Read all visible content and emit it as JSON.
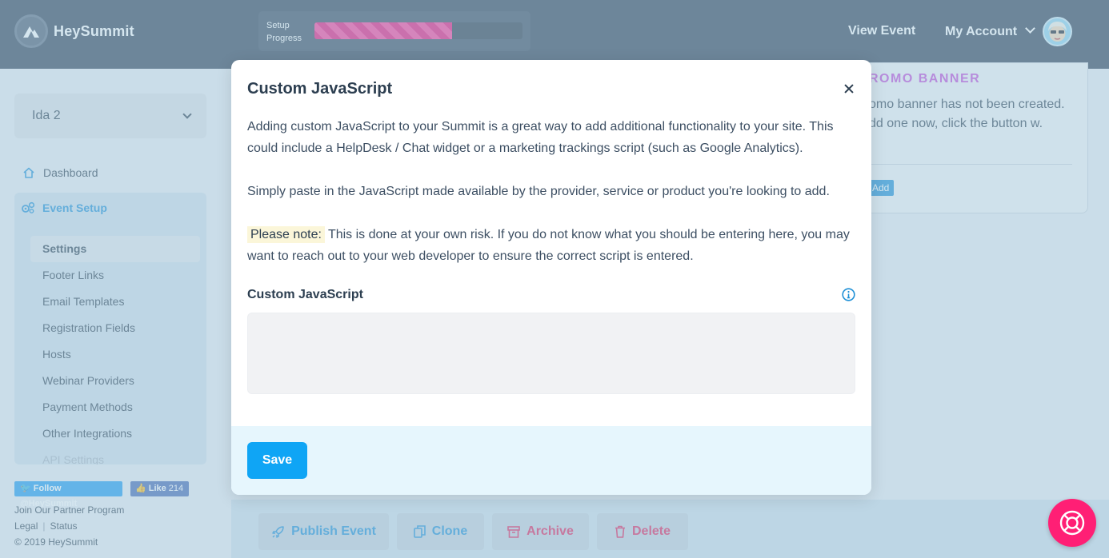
{
  "brand": {
    "name": "HeySummit"
  },
  "header": {
    "progress_label": "Setup Progress",
    "progress_fraction": 0.66,
    "view_event": "View Event",
    "my_account": "My Account"
  },
  "sidebar": {
    "event_name": "Ida 2",
    "dashboard": "Dashboard",
    "event_setup": "Event Setup",
    "items": [
      {
        "label": "Settings"
      },
      {
        "label": "Footer Links"
      },
      {
        "label": "Email Templates"
      },
      {
        "label": "Registration Fields"
      },
      {
        "label": "Hosts"
      },
      {
        "label": "Webinar Providers"
      },
      {
        "label": "Payment Methods"
      },
      {
        "label": "Other Integrations"
      },
      {
        "label": "API Settings"
      }
    ],
    "twitter_follow": "Follow @HeySummit",
    "fb_like": "Like",
    "fb_count": "214",
    "partner_program": "Join Our Partner Program",
    "legal": "Legal",
    "status": "Status",
    "copyright": "© 2019 HeySummit"
  },
  "promo": {
    "title": "ROMO BANNER",
    "text": "omo banner has not been created. dd one now, click the button w.",
    "add_label": "Add"
  },
  "actions": {
    "publish": "Publish Event",
    "clone": "Clone",
    "archive": "Archive",
    "delete": "Delete"
  },
  "modal": {
    "title": "Custom JavaScript",
    "para1": "Adding custom JavaScript to your Summit is a great way to add additional functionality to your site. This could include a HelpDesk / Chat widget or a marketing trackings script (such as Google Analytics).",
    "para2": "Simply paste in the JavaScript made available by the provider, service or product you're looking to add.",
    "note_label": "Please note:",
    "note_text": "This is done at your own risk. If you do not know what you should be entering here, you may want to reach out to your web developer to ensure the correct script is entered.",
    "field_label": "Custom JavaScript",
    "field_value": "",
    "save": "Save"
  },
  "colors": {
    "topbar": "#2e3e55",
    "accent_blue": "#0fa5f5",
    "progress_pink": "#e8127a",
    "danger": "#e0245e",
    "promo_purple": "#c24ad9"
  }
}
